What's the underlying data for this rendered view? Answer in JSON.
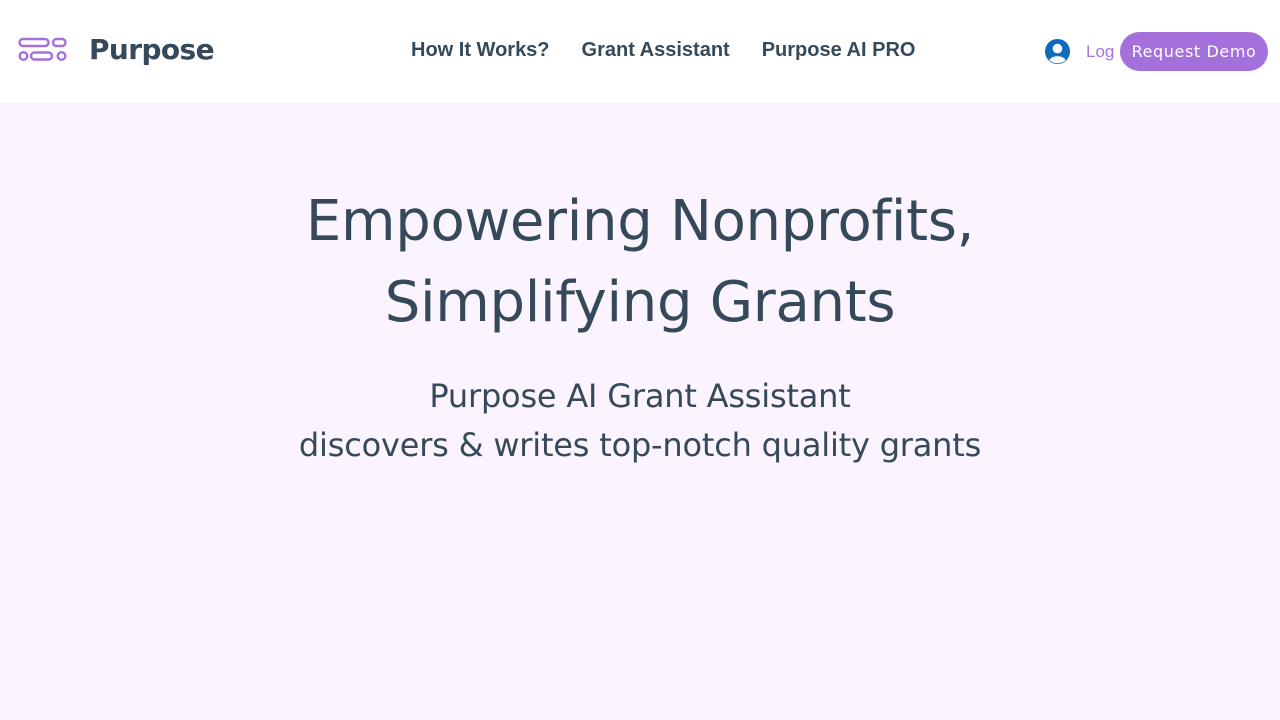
{
  "brand": {
    "name": "Purpose",
    "logo_icon": "purpose-logo-mark",
    "accent_color": "#a370dc",
    "text_color": "#35495a"
  },
  "nav": {
    "items": [
      {
        "label": "How It Works?"
      },
      {
        "label": "Grant Assistant"
      },
      {
        "label": "Purpose AI PRO"
      }
    ]
  },
  "header_actions": {
    "login_icon": "user-avatar-icon",
    "login_label": "Log In",
    "demo_label": "Request Demo"
  },
  "hero": {
    "title_line1": "Empowering Nonprofits,",
    "title_line2": "Simplifying Grants",
    "subtitle_line1": "Purpose AI Grant Assistant",
    "subtitle_line2": "discovers & writes top-notch quality grants"
  },
  "theme": {
    "page_background": "#fbf3fd",
    "header_background": "#ffffff",
    "login_color": "#a874d9",
    "user_icon_color": "#116dff"
  }
}
